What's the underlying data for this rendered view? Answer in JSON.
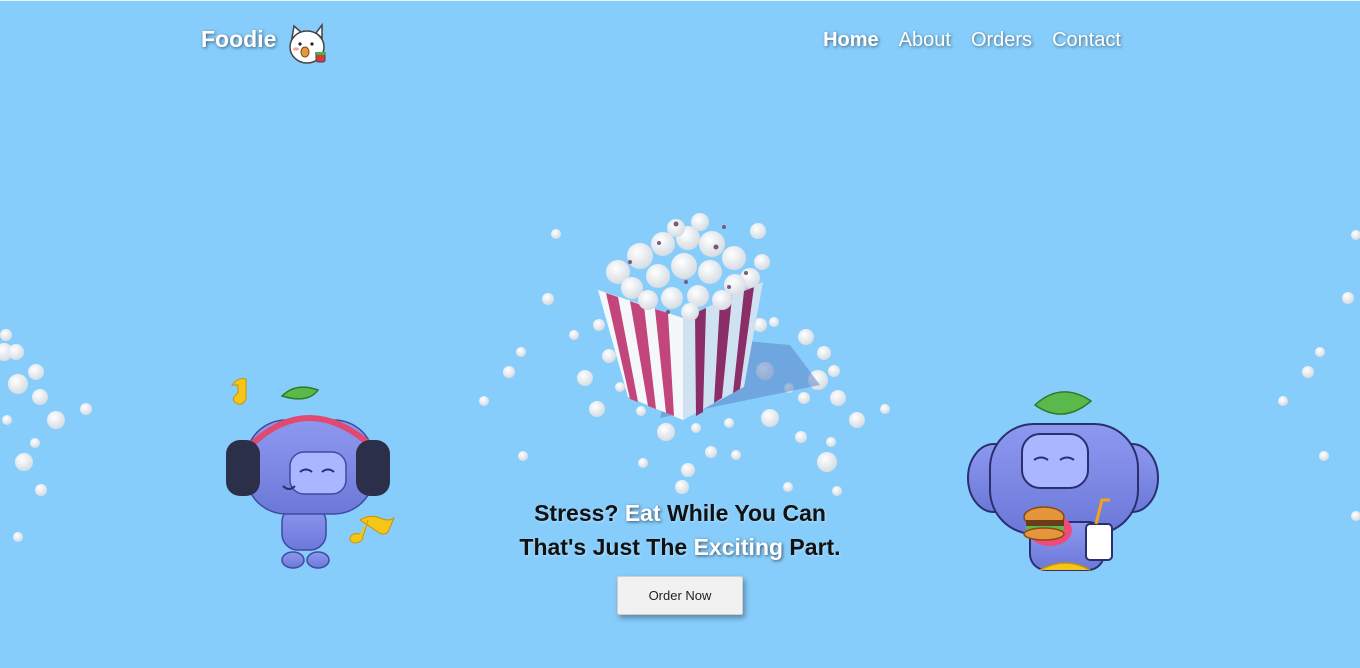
{
  "header": {
    "brand": "Foodie",
    "brand_icon": "cat-eating-icon",
    "nav": [
      {
        "label": "Home",
        "active": true
      },
      {
        "label": "About",
        "active": false
      },
      {
        "label": "Orders",
        "active": false
      },
      {
        "label": "Contact",
        "active": false
      }
    ]
  },
  "hero": {
    "line1": {
      "part1": "Stress? ",
      "highlight": "Eat",
      "part2": " While You Can"
    },
    "line2": {
      "part1": "That's Just The ",
      "highlight": "Exciting",
      "part2": " Part."
    },
    "button_label": "Order Now"
  },
  "illustrations": {
    "left": "headphone-robot-mascot",
    "center": "popcorn-bucket",
    "right": "burger-eating-robot-mascot"
  },
  "colors": {
    "background": "#87cdfb",
    "mascot": "#7b88e8",
    "popcorn_stripe": "#c2457c"
  }
}
